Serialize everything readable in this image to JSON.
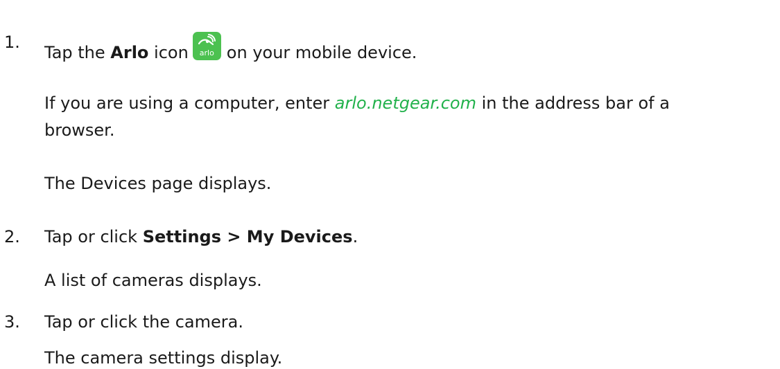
{
  "steps": [
    {
      "number": "1.",
      "before_bold": "Tap the ",
      "bold": "Arlo",
      "after_bold": " icon",
      "icon": "arlo-app-icon",
      "icon_text": "arlo",
      "after_icon": "on your mobile device.",
      "note_before_link": "If you are using a computer, enter ",
      "note_link": "arlo.netgear.com",
      "note_after_link": " in the address bar of a",
      "note_line2": "browser.",
      "result": "The Devices page displays."
    },
    {
      "number": "2.",
      "before_bold": "Tap or click ",
      "bold": "Settings > My Devices",
      "after_bold": ".",
      "result": "A list of cameras displays."
    },
    {
      "number": "3.",
      "text": "Tap or click the camera.",
      "result": "The camera settings display."
    }
  ],
  "colors": {
    "text": "#1a1a1a",
    "link": "#21b14b",
    "icon_background": "#4cc150"
  }
}
